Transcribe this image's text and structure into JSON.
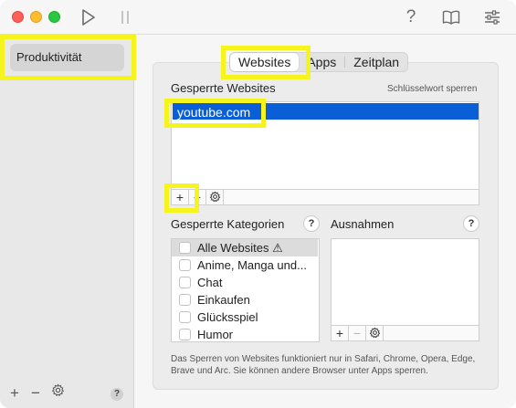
{
  "toolbar": {
    "play_icon": "play-icon",
    "pause_icon": "pause-icon",
    "help_glyph": "?",
    "book_icon": "book-icon",
    "sliders_icon": "sliders-icon"
  },
  "sidebar": {
    "items": [
      {
        "label": "Produktivität"
      }
    ],
    "add_glyph": "+",
    "remove_glyph": "−",
    "help_glyph": "?"
  },
  "tabs": {
    "items": [
      {
        "label": "Websites",
        "active": true
      },
      {
        "label": "Apps",
        "active": false
      },
      {
        "label": "Zeitplan",
        "active": false
      }
    ]
  },
  "websites": {
    "heading": "Gesperrte Websites",
    "keyword_link": "Schlüsselwort sperren",
    "entries": [
      "youtube.com"
    ],
    "add_glyph": "+",
    "remove_glyph": "−"
  },
  "categories": {
    "heading": "Gesperrte Kategorien",
    "help_glyph": "?",
    "items": [
      {
        "label": "Alle Websites ⚠",
        "checked": false
      },
      {
        "label": "Anime, Manga und...",
        "checked": false
      },
      {
        "label": "Chat",
        "checked": false
      },
      {
        "label": "Einkaufen",
        "checked": false
      },
      {
        "label": "Glücksspiel",
        "checked": false
      },
      {
        "label": "Humor",
        "checked": false
      }
    ]
  },
  "exceptions": {
    "heading": "Ausnahmen",
    "help_glyph": "?",
    "add_glyph": "+",
    "remove_glyph": "−"
  },
  "footnote": "Das Sperren von Websites funktioniert nur in Safari, Chrome, Opera, Edge, Brave und Arc. Sie können andere Browser unter Apps sperren.",
  "colors": {
    "selection": "#0a5fd6",
    "highlight": "#f5f51d"
  }
}
